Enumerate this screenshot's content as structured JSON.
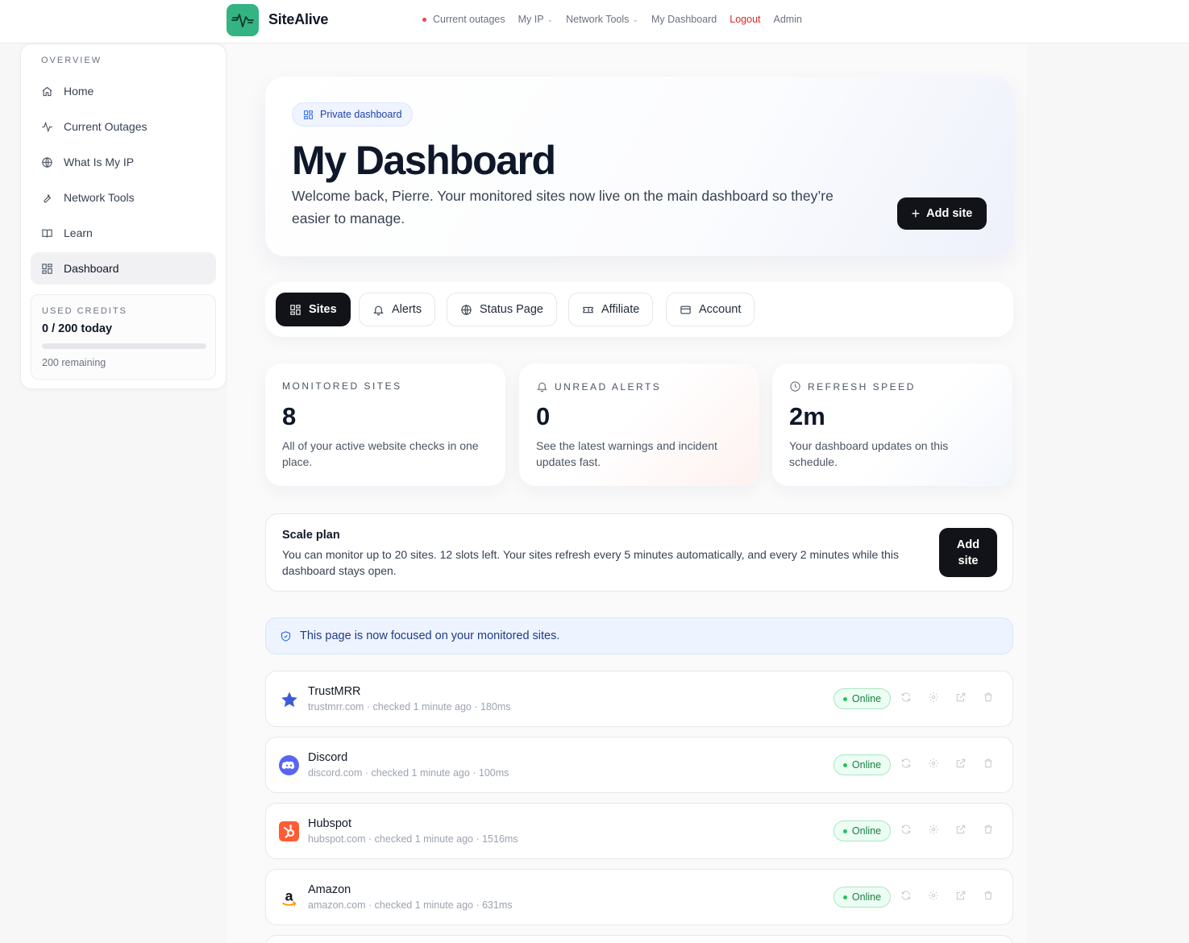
{
  "brand": {
    "name": "SiteAlive"
  },
  "topnav": {
    "current_outages": "Current outages",
    "my_ip": "My IP",
    "network_tools": "Network Tools",
    "my_dashboard": "My Dashboard",
    "logout": "Logout",
    "admin": "Admin"
  },
  "sidebar": {
    "section_label": "OVERVIEW",
    "items": [
      {
        "label": "Home",
        "icon": "home-icon"
      },
      {
        "label": "Current Outages",
        "icon": "activity-icon"
      },
      {
        "label": "What Is My IP",
        "icon": "globe-icon"
      },
      {
        "label": "Network Tools",
        "icon": "wrench-icon"
      },
      {
        "label": "Learn",
        "icon": "book-icon"
      },
      {
        "label": "Dashboard",
        "icon": "grid-icon",
        "active": true
      }
    ],
    "credits": {
      "label": "USED CREDITS",
      "value": "0 / 200 today",
      "used_fraction": 0,
      "remaining": "200 remaining"
    }
  },
  "hero": {
    "pill": "Private dashboard",
    "title": "My Dashboard",
    "subtitle": "Welcome back, Pierre. Your monitored sites now live on the main dashboard so they’re easier to manage.",
    "add_button": "Add site"
  },
  "tabs": [
    {
      "label": "Sites",
      "icon": "grid-icon",
      "active": true
    },
    {
      "label": "Alerts",
      "icon": "bell-icon"
    },
    {
      "label": "Status Page",
      "icon": "globe-icon"
    },
    {
      "label": "Affiliate",
      "icon": "ticket-icon"
    },
    {
      "label": "Account",
      "icon": "card-icon"
    }
  ],
  "stats": [
    {
      "label": "MONITORED SITES",
      "value": "8",
      "desc": "All of your active website checks in one place."
    },
    {
      "label": "UNREAD ALERTS",
      "value": "0",
      "desc": "See the latest warnings and incident updates fast.",
      "icon": "bell-icon"
    },
    {
      "label": "REFRESH SPEED",
      "value": "2m",
      "desc": "Your dashboard updates on this schedule.",
      "icon": "clock-icon"
    }
  ],
  "plan": {
    "title": "Scale plan",
    "desc": "You can monitor up to 20 sites. 12 slots left. Your sites refresh every 5 minutes automatically, and every 2 minutes while this dashboard stays open.",
    "button": "Add site"
  },
  "info": {
    "text": "This page is now focused on your monitored sites."
  },
  "sites": [
    {
      "name": "TrustMRR",
      "meta": "trustmrr.com · checked 1 minute ago · 180ms",
      "status": "Online",
      "icon": "star-icon"
    },
    {
      "name": "Discord",
      "meta": "discord.com · checked 1 minute ago · 100ms",
      "status": "Online",
      "icon": "discord-icon"
    },
    {
      "name": "Hubspot",
      "meta": "hubspot.com · checked 1 minute ago · 1516ms",
      "status": "Online",
      "icon": "hubspot-icon"
    },
    {
      "name": "Amazon",
      "meta": "amazon.com · checked 1 minute ago · 631ms",
      "status": "Online",
      "icon": "amazon-icon"
    }
  ],
  "colors": {
    "accent": "#34b383",
    "dark": "#111318",
    "online": "#15803d",
    "logout": "#dc2626"
  }
}
